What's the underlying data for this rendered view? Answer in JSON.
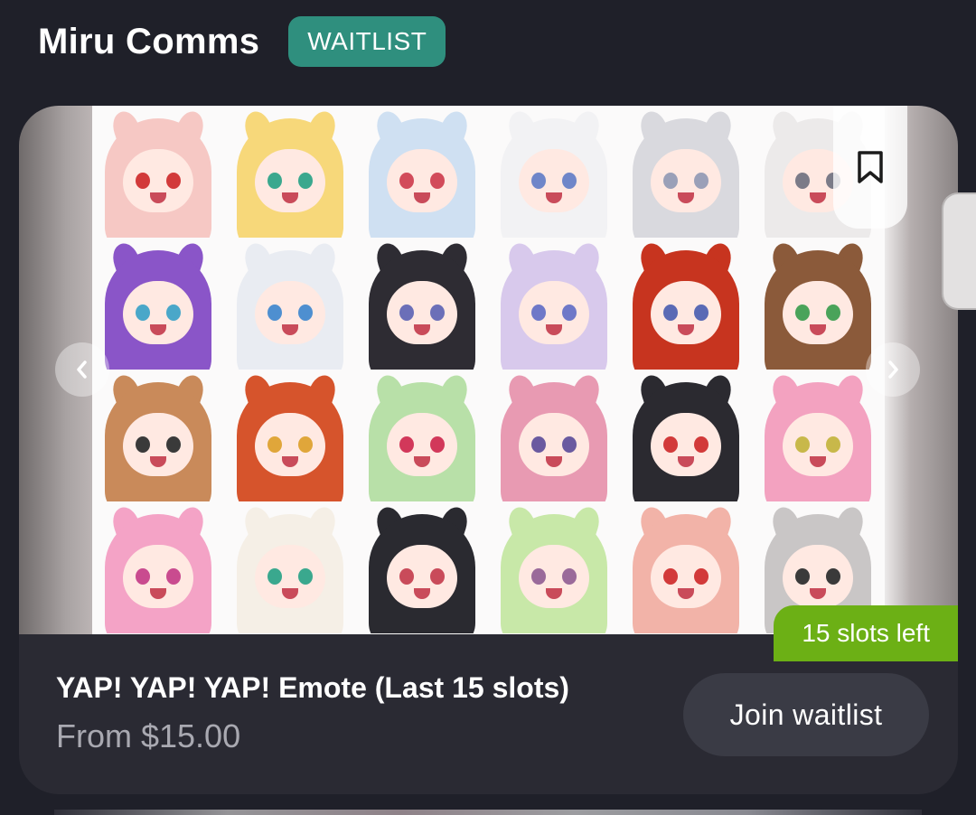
{
  "header": {
    "shop_name": "Miru Comms",
    "status_badge": "WAITLIST"
  },
  "listing": {
    "title": "YAP! YAP! YAP! Emote (Last 15 slots)",
    "price": "From $15.00",
    "slots_badge": "15 slots left",
    "join_button": "Join waitlist",
    "bookmark_icon": "bookmark-icon",
    "prev_icon": "chevron-left-icon",
    "next_icon": "chevron-right-icon"
  },
  "colors": {
    "background": "#1f2029",
    "card": "#2a2a33",
    "waitlist_badge": "#2f8f7e",
    "slots_badge": "#6cb015",
    "button": "#3a3b45",
    "price_text": "#a9a9b1"
  },
  "gallery": {
    "emotes": [
      {
        "hair": "#f6c8c4",
        "eye": "#d23a3a"
      },
      {
        "hair": "#f7d87a",
        "eye": "#3aa88e"
      },
      {
        "hair": "#cfe0f2",
        "eye": "#d24b5a"
      },
      {
        "hair": "#f2f2f4",
        "eye": "#6f86c9"
      },
      {
        "hair": "#d9d9de",
        "eye": "#9aa0b8"
      },
      {
        "hair": "#eceaea",
        "eye": "#7b7b88"
      },
      {
        "hair": "#8a55c8",
        "eye": "#4aa7c9"
      },
      {
        "hair": "#e9ecf2",
        "eye": "#4e8fd0"
      },
      {
        "hair": "#2e2c33",
        "eye": "#6b6fb8"
      },
      {
        "hair": "#d8c9ec",
        "eye": "#6e78c8"
      },
      {
        "hair": "#c7341f",
        "eye": "#5a6ab5"
      },
      {
        "hair": "#8b5a3a",
        "eye": "#4aa35a"
      },
      {
        "hair": "#c98a5a",
        "eye": "#3a3a3a"
      },
      {
        "hair": "#d6542c",
        "eye": "#e0a63a"
      },
      {
        "hair": "#b8e0a8",
        "eye": "#d2385a"
      },
      {
        "hair": "#e89ab2",
        "eye": "#6a5aa0"
      },
      {
        "hair": "#2b2a30",
        "eye": "#d23a3a"
      },
      {
        "hair": "#f3a2c0",
        "eye": "#c8b84a"
      },
      {
        "hair": "#f4a3c6",
        "eye": "#c94b8f"
      },
      {
        "hair": "#f5efe6",
        "eye": "#3aa88e"
      },
      {
        "hair": "#2a2a30",
        "eye": "#c94b5a"
      },
      {
        "hair": "#c8e8a8",
        "eye": "#9a6a9a"
      },
      {
        "hair": "#f2b3a8",
        "eye": "#d23a3a"
      },
      {
        "hair": "#c9c6c6",
        "eye": "#3a3a3a"
      }
    ]
  }
}
